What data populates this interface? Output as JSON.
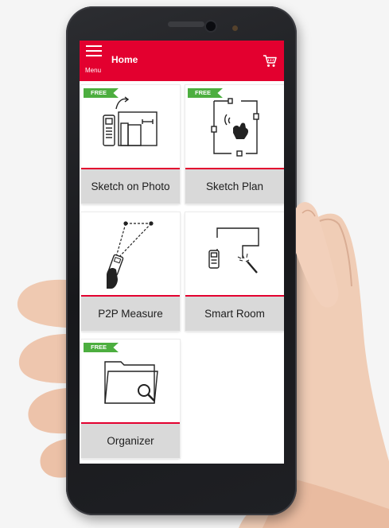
{
  "colors": {
    "accent": "#e3002f",
    "free_badge": "#4cae3f",
    "tile_label_bg": "#d9d9d9"
  },
  "header": {
    "title": "Home",
    "menu_label": "Menu",
    "menu_icon": "hamburger-icon",
    "cart_icon": "cart-icon"
  },
  "tiles": [
    {
      "label": "Sketch on Photo",
      "badge": "FREE",
      "icon": "sketch-on-photo-icon"
    },
    {
      "label": "Sketch Plan",
      "badge": "FREE",
      "icon": "sketch-plan-icon"
    },
    {
      "label": "P2P Measure",
      "icon": "p2p-measure-icon"
    },
    {
      "label": "Smart Room",
      "icon": "smart-room-icon"
    },
    {
      "label": "Organizer",
      "badge": "FREE",
      "icon": "organizer-icon"
    }
  ]
}
